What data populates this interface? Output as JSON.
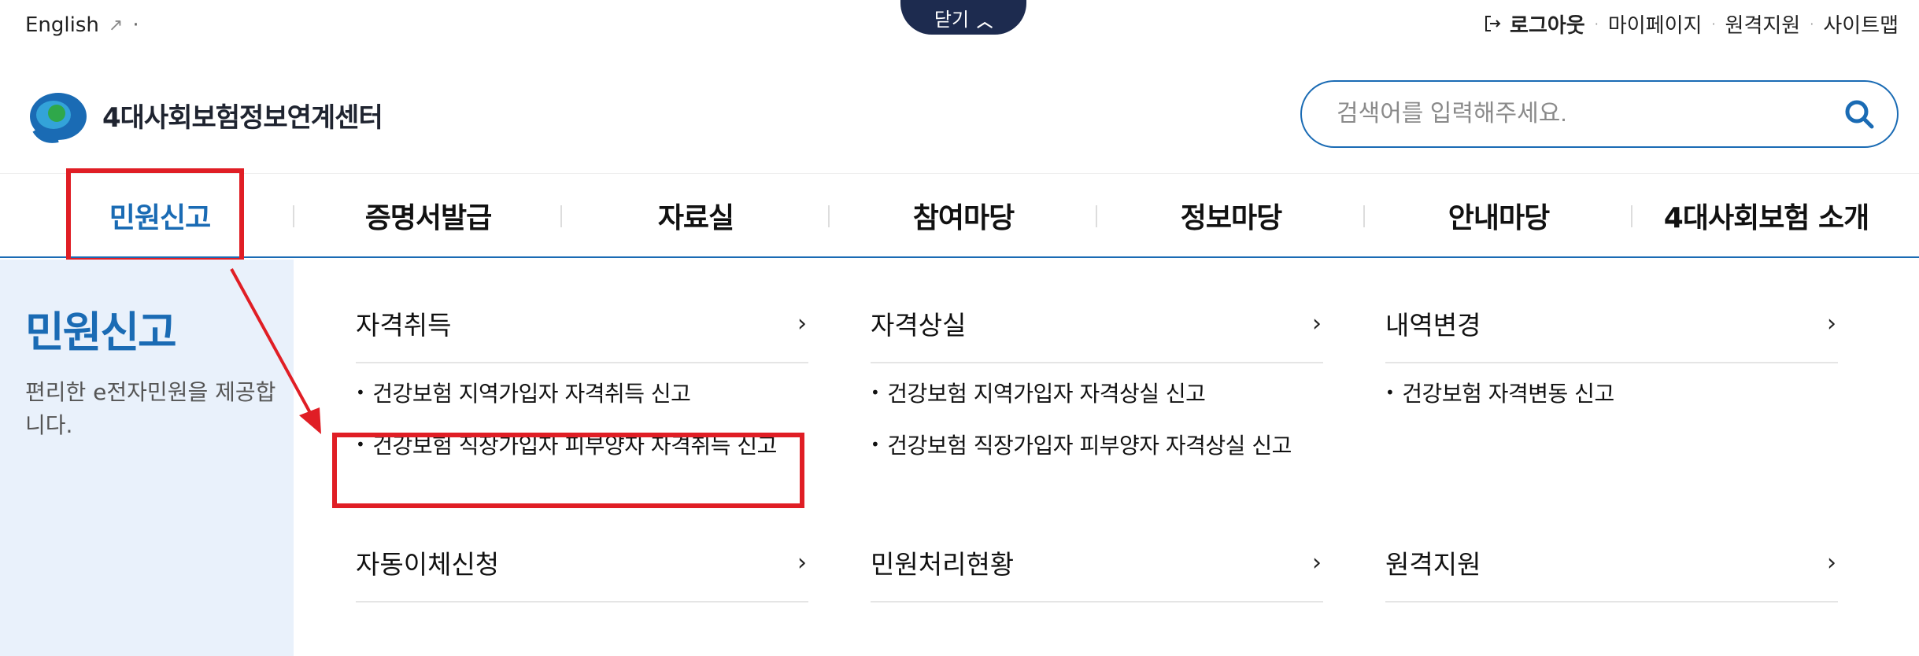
{
  "util": {
    "language": "English",
    "close_label": "닫기",
    "logout": "로그아웃",
    "mypage": "마이페이지",
    "remote": "원격지원",
    "sitemap": "사이트맵"
  },
  "logo": {
    "text": "4대사회보험정보연계센터"
  },
  "search": {
    "placeholder": "검색어를 입력해주세요."
  },
  "nav": [
    {
      "label": "민원신고"
    },
    {
      "label": "증명서발급"
    },
    {
      "label": "자료실"
    },
    {
      "label": "참여마당"
    },
    {
      "label": "정보마당"
    },
    {
      "label": "안내마당"
    },
    {
      "label": "4대사회보험 소개"
    }
  ],
  "side": {
    "title": "민원신고",
    "desc": "편리한 e전자민원을 제공합니다."
  },
  "menu": [
    {
      "title": "자격취득",
      "items": [
        "건강보험 지역가입자 자격취득 신고",
        "건강보험 직장가입자 피부양자 자격취득 신고"
      ]
    },
    {
      "title": "자격상실",
      "items": [
        "건강보험 지역가입자 자격상실 신고",
        "건강보험 직장가입자 피부양자 자격상실 신고"
      ]
    },
    {
      "title": "내역변경",
      "items": [
        "건강보험 자격변동 신고"
      ]
    },
    {
      "title": "자동이체신청",
      "items": []
    },
    {
      "title": "민원처리현황",
      "items": []
    },
    {
      "title": "원격지원",
      "items": []
    }
  ],
  "colors": {
    "accent": "#1a6bb4",
    "highlight": "#e01e25",
    "navy": "#1d2b4f",
    "side_bg": "#e9f1fb"
  }
}
